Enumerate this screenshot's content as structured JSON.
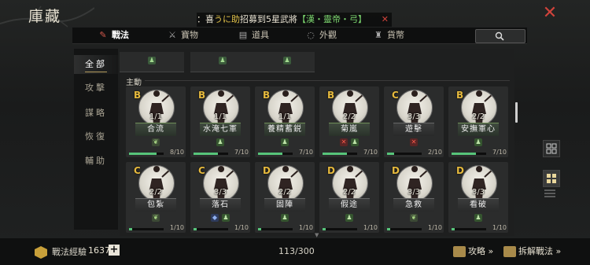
{
  "header": {
    "title": "庫藏"
  },
  "announcement": {
    "prefix": "：喜",
    "name": "うに助",
    "text": "招募到5星武將",
    "detail": "【漢・靈帝・弓】"
  },
  "tabs": [
    {
      "label": "戰法",
      "icon": "scroll-icon"
    },
    {
      "label": "寶物",
      "icon": "treasure-icon"
    },
    {
      "label": "道具",
      "icon": "item-icon"
    },
    {
      "label": "外觀",
      "icon": "appearance-icon"
    },
    {
      "label": "貨幣",
      "icon": "currency-icon"
    }
  ],
  "sidebar": {
    "items": [
      {
        "label": "全部",
        "active": true
      },
      {
        "label": "攻擊",
        "active": false
      },
      {
        "label": "謀略",
        "active": false
      },
      {
        "label": "恢復",
        "active": false
      },
      {
        "label": "輔助",
        "active": false
      }
    ]
  },
  "section": {
    "label": "主動"
  },
  "cards": [
    {
      "grade": "B",
      "level": "1/1",
      "name": "合流",
      "badges": [
        "leaf"
      ],
      "count": "8/10",
      "progress": 0.8,
      "plate": "green"
    },
    {
      "grade": "B",
      "level": "1/1",
      "name": "水淹七軍",
      "badges": [
        "man"
      ],
      "count": "7/10",
      "progress": 0.7,
      "plate": "green"
    },
    {
      "grade": "B",
      "level": "1/1",
      "name": "養精蓄鋭",
      "badges": [
        "man"
      ],
      "count": "7/10",
      "progress": 0.7,
      "plate": "green"
    },
    {
      "grade": "B",
      "level": "2/2",
      "name": "菊嵐",
      "badges": [
        "x",
        "man"
      ],
      "count": "7/10",
      "progress": 0.7,
      "plate": "green"
    },
    {
      "grade": "C",
      "level": "3/3",
      "name": "遊擊",
      "badges": [
        "x"
      ],
      "count": "2/10",
      "progress": 0.2,
      "plate": "grey"
    },
    {
      "grade": "B",
      "level": "2/2",
      "name": "安撫軍心",
      "badges": [
        "man"
      ],
      "count": "7/10",
      "progress": 0.7,
      "plate": "green"
    },
    {
      "grade": "C",
      "level": "2/2",
      "name": "包紮",
      "badges": [
        "leaf"
      ],
      "count": "1/10",
      "progress": 0.1,
      "plate": "grey"
    },
    {
      "grade": "C",
      "level": "3/3",
      "name": "落石",
      "badges": [
        "blue",
        "man"
      ],
      "count": "1/10",
      "progress": 0.1,
      "plate": "grey"
    },
    {
      "grade": "D",
      "level": "2/2",
      "name": "固陣",
      "badges": [
        "man"
      ],
      "count": "1/10",
      "progress": 0.1,
      "plate": "grey"
    },
    {
      "grade": "D",
      "level": "2/2",
      "name": "假途",
      "badges": [
        "man"
      ],
      "count": "1/10",
      "progress": 0.1,
      "plate": "grey"
    },
    {
      "grade": "D",
      "level": "3/3",
      "name": "急救",
      "badges": [
        "leaf"
      ],
      "count": "1/10",
      "progress": 0.1,
      "plate": "grey"
    },
    {
      "grade": "D",
      "level": "3/3",
      "name": "看破",
      "badges": [
        "man"
      ],
      "count": "1/10",
      "progress": 0.1,
      "plate": "grey"
    }
  ],
  "footer": {
    "exp_label": "戰法經驗",
    "exp_value": "1637",
    "plus_label": "+",
    "count": "113/300",
    "guide_label": "攻略 »",
    "decompose_label": "拆解戰法 »"
  }
}
